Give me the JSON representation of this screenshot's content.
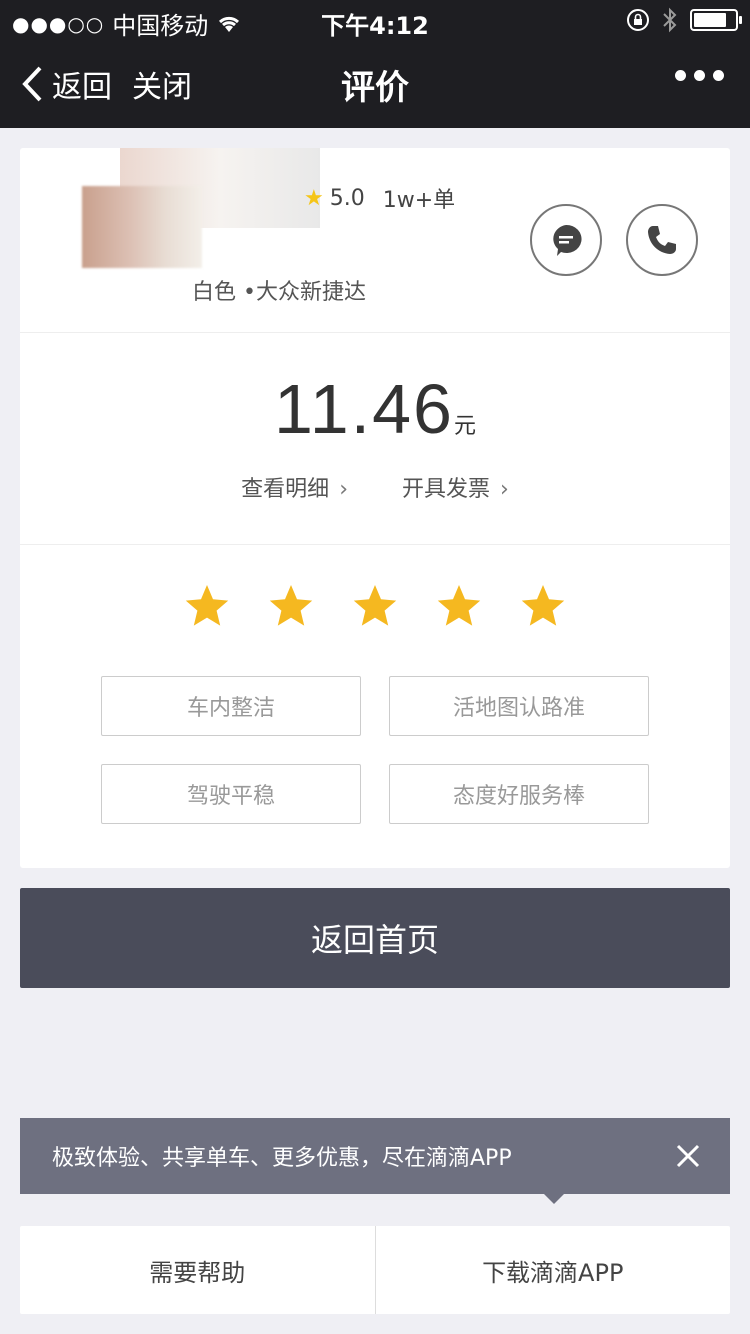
{
  "status_bar": {
    "signal": "●●●○○",
    "carrier": "中国移动",
    "wifi_icon": "wifi-icon",
    "time": "下午4:12",
    "lock_icon": "rotation-lock-icon",
    "bluetooth_icon": "bluetooth-icon",
    "battery_level": 0.8
  },
  "nav": {
    "back_label": "返回",
    "close_label": "关闭",
    "title": "评价",
    "more_icon": "more-dots-icon"
  },
  "driver": {
    "rating": "5.0",
    "orders": "1w+单",
    "car": "白色 •大众新捷达",
    "message_icon": "chat-bubble-icon",
    "phone_icon": "phone-icon"
  },
  "fare": {
    "amount": "11.46",
    "unit": "元",
    "detail_link": "查看明细",
    "invoice_link": "开具发票"
  },
  "rating": {
    "stars_selected": 5,
    "stars_total": 5,
    "star_color": "#f5b820"
  },
  "tags": [
    "车内整洁",
    "活地图认路准",
    "驾驶平稳",
    "态度好服务棒"
  ],
  "home_button": "返回首页",
  "banner": {
    "text": "极致体验、共享单车、更多优惠，尽在滴滴APP",
    "close_icon": "close-icon"
  },
  "bottom": {
    "help": "需要帮助",
    "download": "下载滴滴APP"
  },
  "colors": {
    "nav_bg": "#1e1e22",
    "button_bg": "#4a4c5a",
    "banner_bg": "#6e7080",
    "page_bg": "#efeff4"
  }
}
